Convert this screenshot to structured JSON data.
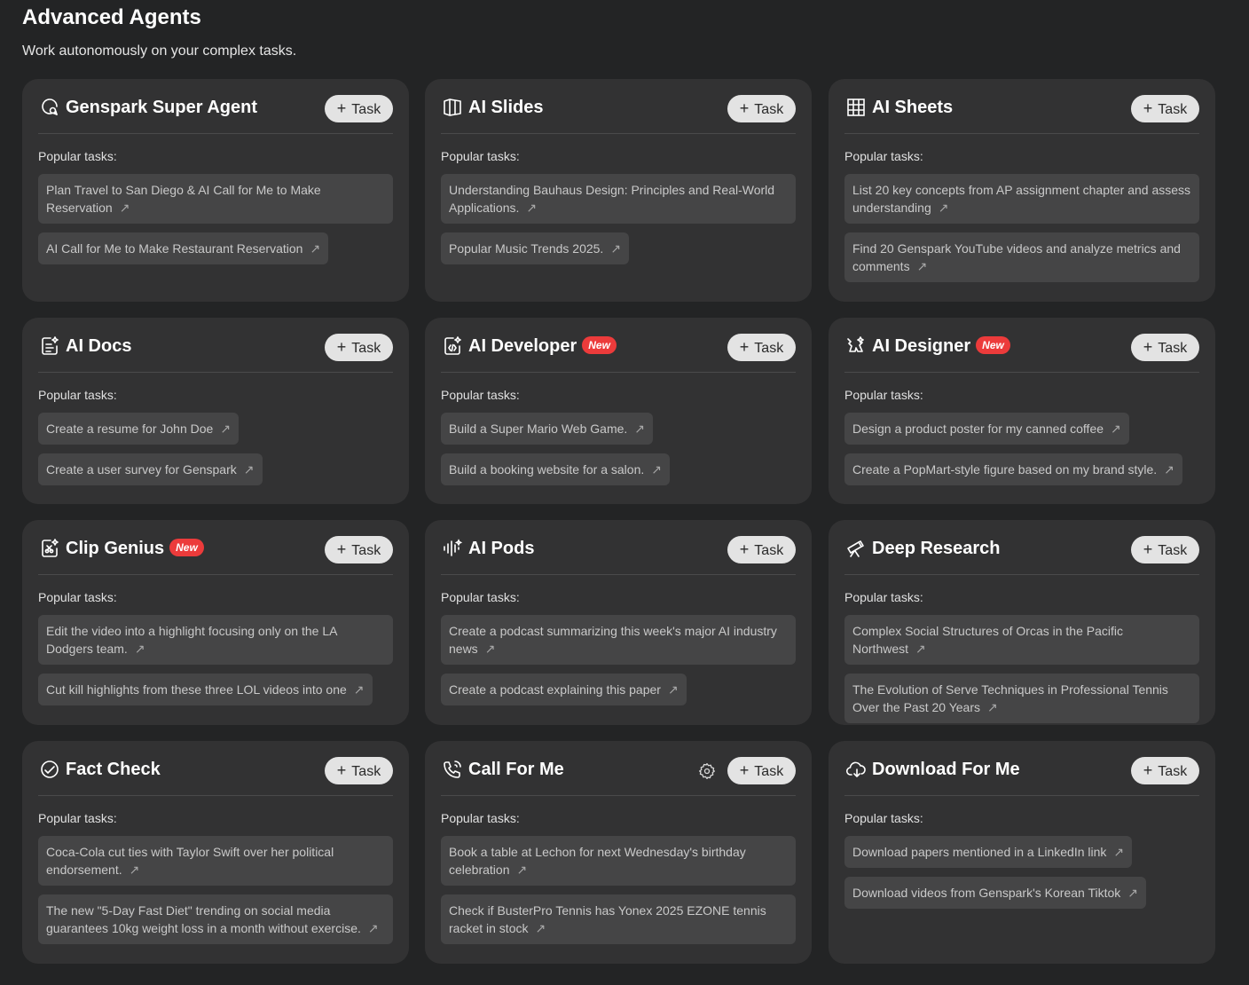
{
  "header": {
    "title": "Advanced Agents",
    "subtitle": "Work autonomously on your complex tasks."
  },
  "task_button_label": "Task",
  "popular_label": "Popular tasks:",
  "new_badge": "New",
  "cards": [
    {
      "name": "Genspark Super Agent",
      "icon": "chat-search-icon",
      "isNew": false,
      "tasks": [
        "Plan Travel to San Diego & AI Call for Me to Make Reservation",
        "AI Call for Me to Make Restaurant Reservation"
      ]
    },
    {
      "name": "AI Slides",
      "icon": "slides-icon",
      "isNew": false,
      "tasks": [
        "Understanding Bauhaus Design: Principles and Real-World Applications.",
        "Popular Music Trends 2025."
      ]
    },
    {
      "name": "AI Sheets",
      "icon": "grid-icon",
      "isNew": false,
      "tasks": [
        "List 20 key concepts from AP assignment chapter and assess understanding",
        "Find 20 Genspark YouTube videos and analyze metrics and comments"
      ]
    },
    {
      "name": "AI Docs",
      "icon": "document-icon",
      "isNew": false,
      "tasks": [
        "Create a resume for John Doe",
        "Create a user survey for Genspark"
      ]
    },
    {
      "name": "AI Developer",
      "icon": "code-icon",
      "isNew": true,
      "tasks": [
        "Build a Super Mario Web Game.",
        "Build a booking website for a salon."
      ]
    },
    {
      "name": "AI Designer",
      "icon": "design-icon",
      "isNew": true,
      "tasks": [
        "Design a product poster for my canned coffee",
        "Create a PopMart-style figure based on my brand style."
      ]
    },
    {
      "name": "Clip Genius",
      "icon": "clip-icon",
      "isNew": true,
      "tasks": [
        "Edit the video into a highlight focusing only on the LA Dodgers team.",
        "Cut kill highlights from these three LOL videos into one"
      ]
    },
    {
      "name": "AI Pods",
      "icon": "soundwave-icon",
      "isNew": false,
      "tasks": [
        "Create a podcast summarizing this week's major AI industry news",
        "Create a podcast explaining this paper"
      ]
    },
    {
      "name": "Deep Research",
      "icon": "telescope-icon",
      "isNew": false,
      "tasks": [
        "Complex Social Structures of Orcas in the Pacific Northwest",
        "The Evolution of Serve Techniques in Professional Tennis Over the Past 20 Years"
      ]
    },
    {
      "name": "Fact Check",
      "icon": "check-circle-icon",
      "isNew": false,
      "tasks": [
        "Coca-Cola cut ties with Taylor Swift over her political endorsement.",
        "The new \"5-Day Fast Diet\" trending on social media guarantees 10kg weight loss in a month without exercise."
      ]
    },
    {
      "name": "Call For Me",
      "icon": "phone-icon",
      "isNew": false,
      "hasSettings": true,
      "tasks": [
        "Book a table at Lechon for next Wednesday's birthday celebration",
        "Check if BusterPro Tennis has Yonex 2025 EZONE tennis racket in stock"
      ]
    },
    {
      "name": "Download For Me",
      "icon": "cloud-download-icon",
      "isNew": false,
      "tasks": [
        "Download papers mentioned in a LinkedIn link",
        "Download videos from Genspark's Korean Tiktok"
      ]
    }
  ]
}
